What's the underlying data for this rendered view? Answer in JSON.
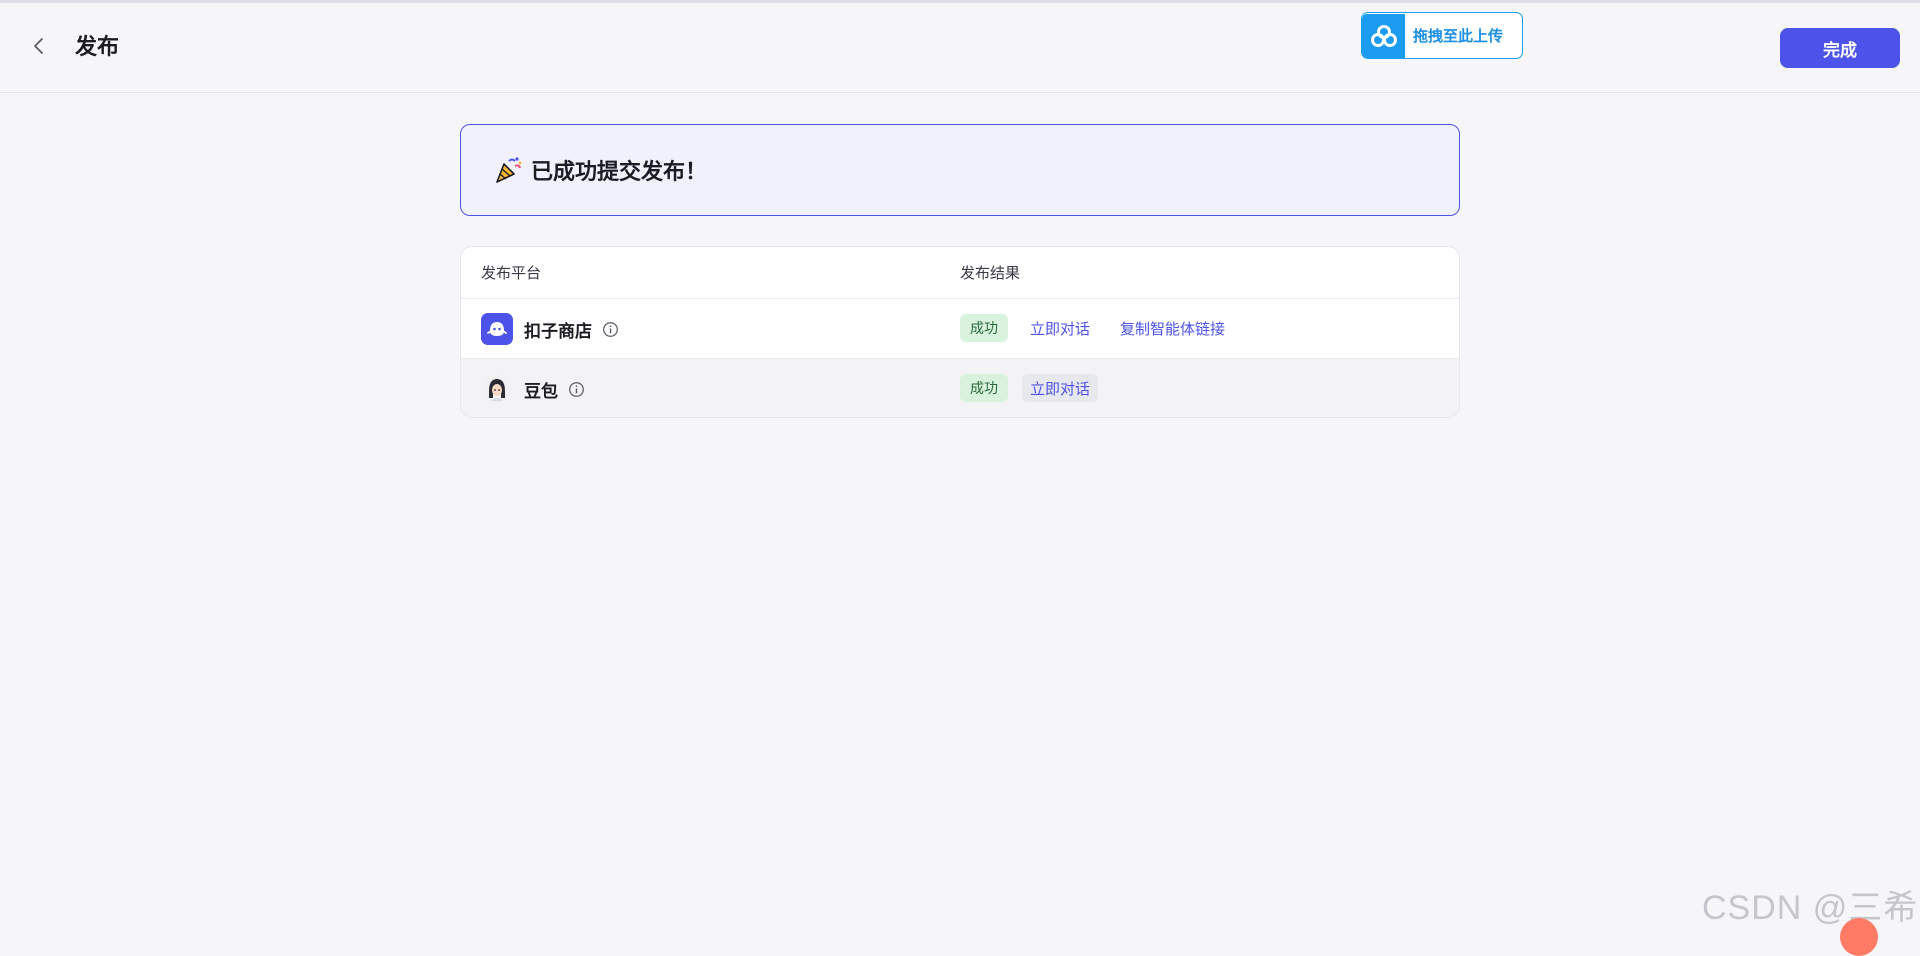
{
  "header": {
    "title": "发布",
    "upload_label": "拖拽至此上传",
    "done_label": "完成"
  },
  "banner": {
    "message": "已成功提交发布！"
  },
  "table": {
    "columns": [
      "发布平台",
      "发布结果"
    ],
    "rows": [
      {
        "platform": "扣子商店",
        "status": "成功",
        "actions": [
          "立即对话",
          "复制智能体链接"
        ]
      },
      {
        "platform": "豆包",
        "status": "成功",
        "actions": [
          "立即对话"
        ]
      }
    ]
  },
  "watermark": "CSDN @三希",
  "colors": {
    "accent": "#4d53e8",
    "success_bg": "#d9f2dd",
    "success_text": "#2c6b3d",
    "upload_blue": "#1b9cf0"
  }
}
